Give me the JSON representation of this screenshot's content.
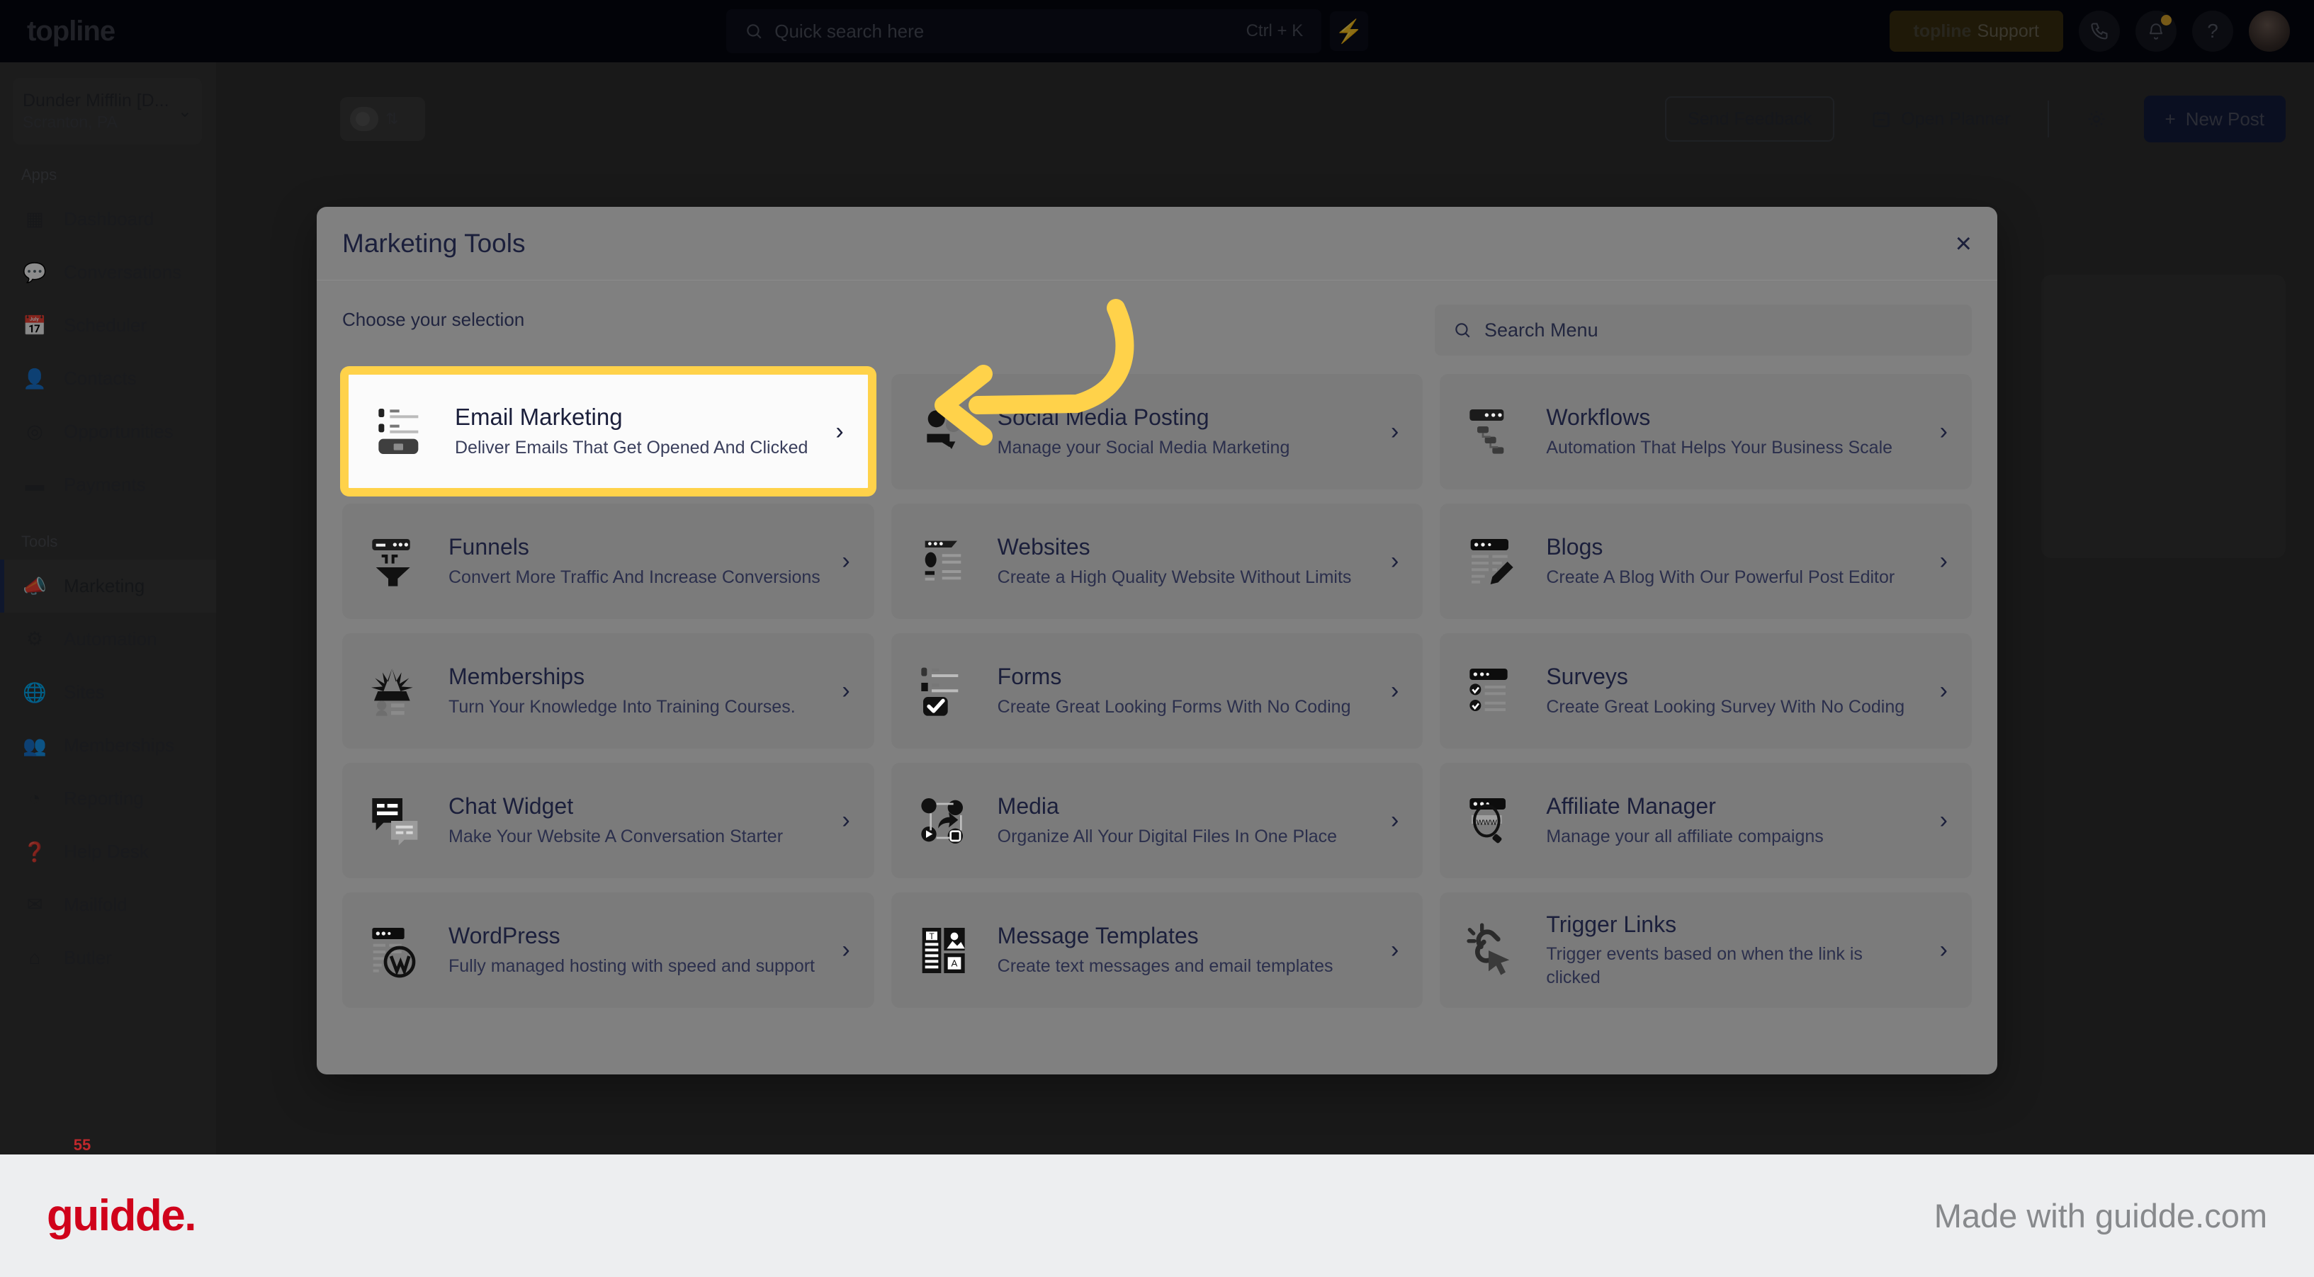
{
  "topbar": {
    "brand": "topline",
    "search": {
      "placeholder": "Quick search here",
      "shortcut": "Ctrl + K",
      "icon": "search-icon"
    },
    "bolt_icon": "lightning-bolt-icon",
    "support_brand": "topline",
    "support_label": "Support",
    "phone_icon": "☎",
    "bell_icon": "🔔",
    "help_icon": "?",
    "avatar": "user-avatar"
  },
  "sidebar": {
    "org_name": "Dunder Mifflin [D...",
    "org_location": "Scranton, PA",
    "apps_label": "Apps",
    "tools_label": "Tools",
    "apps": [
      {
        "label": "Dashboard",
        "icon": "dashboard-icon",
        "glyph": "▦"
      },
      {
        "label": "Conversations",
        "icon": "chat-bubbles-icon",
        "glyph": "💬"
      },
      {
        "label": "Scheduler",
        "icon": "calendar-icon",
        "glyph": "📅"
      },
      {
        "label": "Contacts",
        "icon": "person-icon",
        "glyph": "👤"
      },
      {
        "label": "Opportunities",
        "icon": "target-icon",
        "glyph": "◎"
      },
      {
        "label": "Payments",
        "icon": "credit-card-icon",
        "glyph": "▬"
      }
    ],
    "tools": [
      {
        "label": "Marketing",
        "icon": "megaphone-icon",
        "glyph": "📣",
        "active": true
      },
      {
        "label": "Automation",
        "icon": "gears-icon",
        "glyph": "⚙",
        "active": false
      },
      {
        "label": "Sites",
        "icon": "globe-icon",
        "glyph": "🌐",
        "active": false
      },
      {
        "label": "Memberships",
        "icon": "people-group-icon",
        "glyph": "👥",
        "active": false
      },
      {
        "label": "Reporting",
        "icon": "pie-chart-icon",
        "glyph": "◔",
        "active": false
      },
      {
        "label": "Help Desk",
        "icon": "question-circle-icon",
        "glyph": "❓",
        "active": false
      },
      {
        "label": "Mailfold",
        "icon": "mail-stack-icon",
        "glyph": "✉",
        "active": false
      },
      {
        "label": "Butler",
        "icon": "bell-service-icon",
        "glyph": "⌂",
        "active": false
      }
    ]
  },
  "toolbar": {
    "send_feedback": "Send Feedback",
    "open_planner": "Open Planner",
    "planner_icon": "calendar-icon",
    "gear_icon": "gear-icon",
    "new_post": "New Post",
    "new_post_plus": "+"
  },
  "modal": {
    "title": "Marketing Tools",
    "close_icon": "close-icon",
    "choose_label": "Choose your selection",
    "search": {
      "placeholder": "Search Menu",
      "icon": "search-icon"
    },
    "chevron": "›",
    "cards": [
      {
        "title": "Email Marketing",
        "desc": "Deliver Emails That Get Opened And Clicked",
        "icon": "email-marketing-icon",
        "featured": true
      },
      {
        "title": "Social Media Posting",
        "desc": "Manage your Social Media Marketing",
        "icon": "social-media-icon",
        "featured": false
      },
      {
        "title": "Workflows",
        "desc": "Automation That Helps Your Business Scale",
        "icon": "workflows-icon",
        "featured": false
      },
      {
        "title": "Funnels",
        "desc": "Convert More Traffic And Increase Conversions",
        "icon": "funnel-icon",
        "featured": false
      },
      {
        "title": "Websites",
        "desc": "Create a High Quality Website Without Limits",
        "icon": "website-icon",
        "featured": false
      },
      {
        "title": "Blogs",
        "desc": "Create A Blog With Our Powerful Post Editor",
        "icon": "blog-pencil-icon",
        "featured": false
      },
      {
        "title": "Memberships",
        "desc": "Turn Your Knowledge Into Training Courses.",
        "icon": "memberships-icon",
        "featured": false
      },
      {
        "title": "Forms",
        "desc": "Create Great Looking Forms With No Coding",
        "icon": "forms-checkbox-icon",
        "featured": false
      },
      {
        "title": "Surveys",
        "desc": "Create Great Looking Survey With No Coding",
        "icon": "surveys-icon",
        "featured": false
      },
      {
        "title": "Chat Widget",
        "desc": "Make Your Website A Conversation Starter",
        "icon": "chat-widget-icon",
        "featured": false
      },
      {
        "title": "Media",
        "desc": "Organize All Your Digital Files In One Place",
        "icon": "media-share-icon",
        "featured": false
      },
      {
        "title": "Affiliate Manager",
        "desc": "Manage your all affiliate compaigns",
        "icon": "affiliate-www-icon",
        "featured": false
      },
      {
        "title": "WordPress",
        "desc": "Fully managed hosting with speed and support",
        "icon": "wordpress-icon",
        "featured": false
      },
      {
        "title": "Message Templates",
        "desc": "Create text messages and email templates",
        "icon": "message-templates-icon",
        "featured": false
      },
      {
        "title": "Trigger Links",
        "desc": "Trigger events based on when the link is clicked",
        "icon": "trigger-links-cursor-icon",
        "featured": false
      }
    ]
  },
  "annotation": {
    "arrow_color": "#FFD24A",
    "highlight_color": "#FFD24A"
  },
  "footer": {
    "logo": "guidde.",
    "made_with": "Made with guidde.com",
    "badge": "55"
  }
}
